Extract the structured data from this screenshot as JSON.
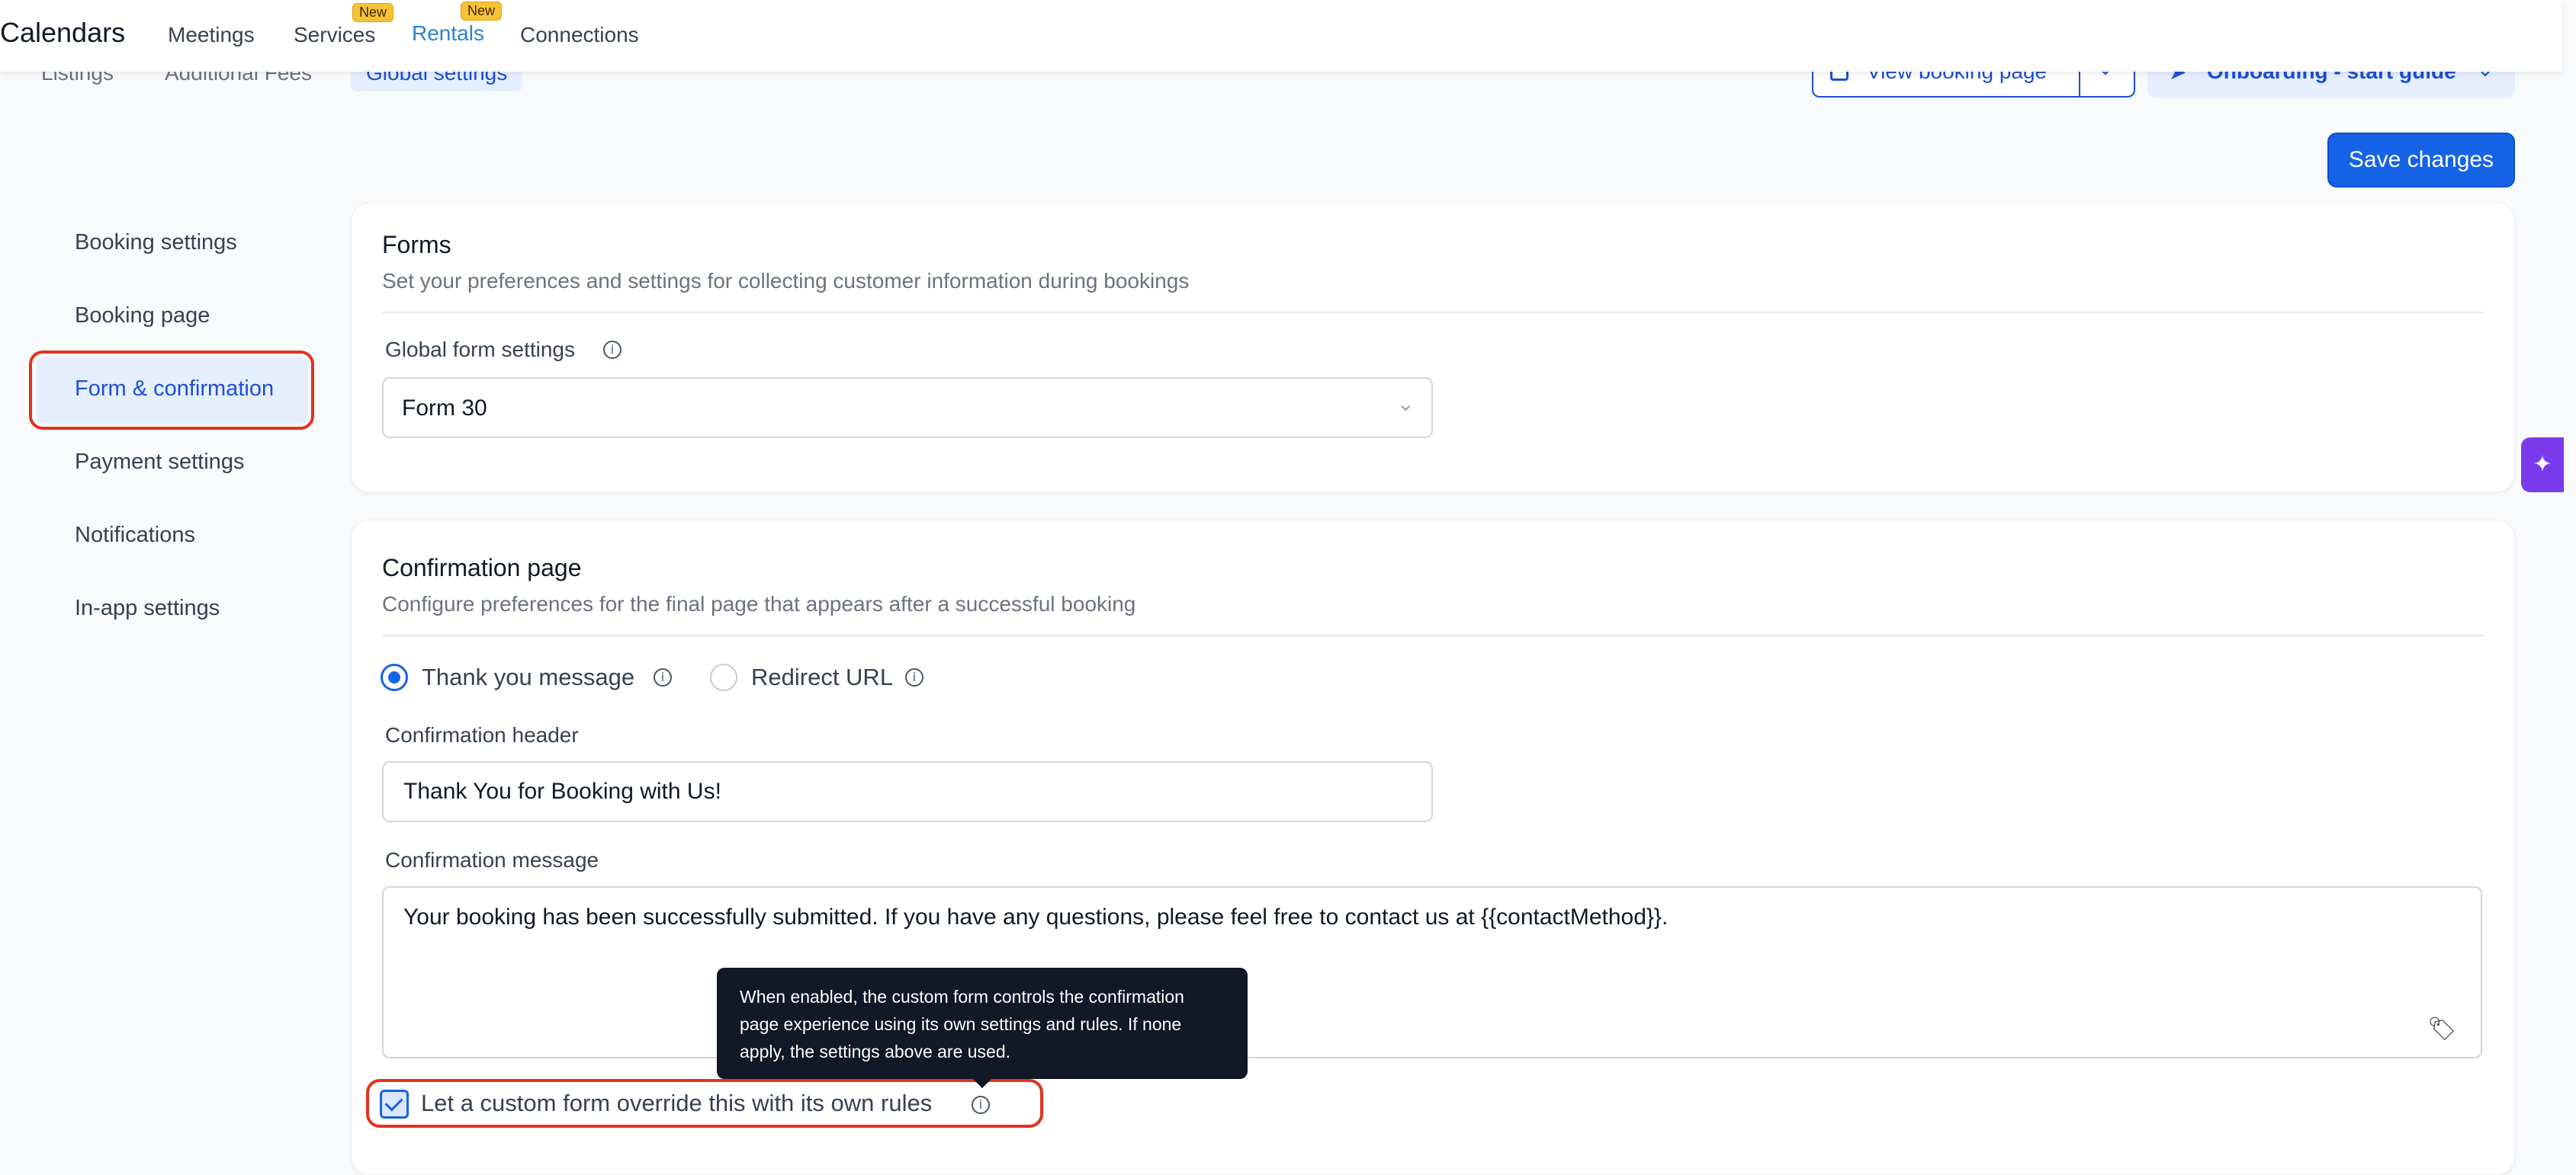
{
  "topbar": {
    "app_title": "Calendars",
    "nav": [
      {
        "label": "Meetings"
      },
      {
        "label": "Services",
        "badge": "New"
      },
      {
        "label": "Rentals",
        "badge": "New",
        "active": true
      },
      {
        "label": "Connections"
      }
    ]
  },
  "subnav": {
    "tabs": [
      {
        "label": "Listings"
      },
      {
        "label": "Additional Fees"
      },
      {
        "label": "Global settings",
        "active": true
      }
    ],
    "view_booking_label": "View booking page",
    "onboarding_label": "Onboarding - start guide"
  },
  "save_label": "Save changes",
  "sidebar": {
    "items": [
      {
        "label": "Booking settings"
      },
      {
        "label": "Booking page"
      },
      {
        "label": "Form & confirmation",
        "active": true
      },
      {
        "label": "Payment settings"
      },
      {
        "label": "Notifications"
      },
      {
        "label": "In-app settings"
      }
    ]
  },
  "forms_card": {
    "title": "Forms",
    "description": "Set your preferences and settings for collecting customer information during bookings",
    "global_label": "Global form settings",
    "selected_form": "Form 30"
  },
  "confirmation_card": {
    "title": "Confirmation page",
    "description": "Configure preferences for the final page that appears after a successful booking",
    "radio_thank_you": "Thank you message",
    "radio_redirect": "Redirect URL",
    "header_label": "Confirmation header",
    "header_value": "Thank You for Booking with Us!",
    "message_label": "Confirmation message",
    "message_value": "Your booking has been successfully submitted. If you have any questions, please feel free to contact us at {{contactMethod}}.",
    "override_label": "Let a custom form override this with its own rules",
    "tooltip_text": "When enabled, the custom form controls the confirmation page experience using its own settings and rules. If none apply, the settings above are used."
  },
  "icons": {
    "info": "info-icon",
    "chevron": "chevron-down-icon",
    "tag": "tag-icon",
    "ai": "sparkle-icon"
  },
  "colors": {
    "accent": "#1563e6",
    "highlight_ring": "#e2321f",
    "badge": "#f8c235",
    "tooltip_bg": "#111827"
  }
}
